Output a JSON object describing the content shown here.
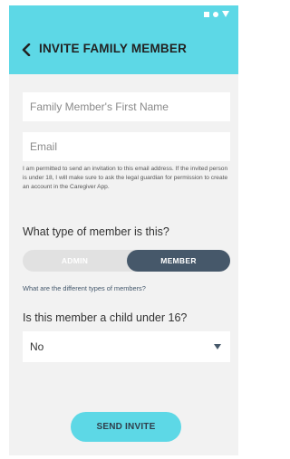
{
  "header": {
    "title": "INVITE FAMILY MEMBER",
    "back_icon": "chevron-left-icon"
  },
  "form": {
    "first_name_placeholder": "Family Member's First Name",
    "email_placeholder": "Email",
    "consent_note": "I am permitted to send an invitation to this email address. If the invited person is under 18, I will make sure to ask the legal guardian for permission to create an account in the Caregiver App.",
    "member_type_question": "What type of member is this?",
    "member_type_options": [
      "ADMIN",
      "MEMBER"
    ],
    "member_type_selected": "MEMBER",
    "member_types_link": "What are the different types of members?",
    "child_question": "Is this member a child under 16?",
    "child_value": "No",
    "send_button": "SEND INVITE"
  },
  "colors": {
    "accent": "#5dd8e6",
    "toggle_active": "#46586a",
    "background": "#f2f2f2"
  }
}
